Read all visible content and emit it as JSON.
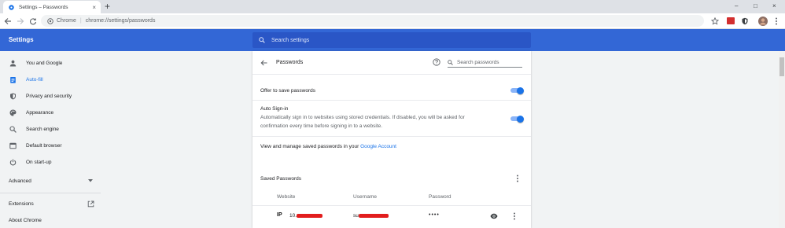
{
  "browser": {
    "tab_title": "Settings – Passwords",
    "tab_close": "×",
    "new_tab": "+",
    "window_controls": [
      "–",
      "□",
      "×"
    ],
    "omnibox_chip": "Chrome",
    "omnibox_url": "chrome://settings/passwords"
  },
  "header": {
    "title": "Settings",
    "search_placeholder": "Search settings"
  },
  "sidebar": {
    "items": [
      {
        "label": "You and Google",
        "icon": "person-icon"
      },
      {
        "label": "Auto-fill",
        "icon": "clipboard-icon",
        "active": true
      },
      {
        "label": "Privacy and security",
        "icon": "shield-icon"
      },
      {
        "label": "Appearance",
        "icon": "palette-icon"
      },
      {
        "label": "Search engine",
        "icon": "search-icon"
      },
      {
        "label": "Default browser",
        "icon": "browser-icon"
      },
      {
        "label": "On start-up",
        "icon": "power-icon"
      }
    ],
    "advanced": "Advanced",
    "extensions": "Extensions",
    "about": "About Chrome"
  },
  "passwords": {
    "title": "Passwords",
    "search_placeholder": "Search passwords",
    "offer_label": "Offer to save passwords",
    "offer_enabled": true,
    "autosignin_title": "Auto Sign-in",
    "autosignin_desc_1": "Automatically sign in to websites using stored credentials. If disabled, you will be asked for",
    "autosignin_desc_2": "confirmation every time before signing in to a website.",
    "autosignin_enabled": true,
    "manage_text": "View and manage saved passwords in your",
    "manage_link": "Google Account",
    "saved_title": "Saved Passwords",
    "columns": {
      "website": "Website",
      "username": "Username",
      "password": "Password"
    },
    "rows": [
      {
        "site_prefix": "10.",
        "user_prefix": "su",
        "password_mask": "••••"
      }
    ]
  },
  "colors": {
    "header_blue": "#3367d6",
    "accent": "#1a73e8",
    "redaction": "#e21d1d"
  }
}
